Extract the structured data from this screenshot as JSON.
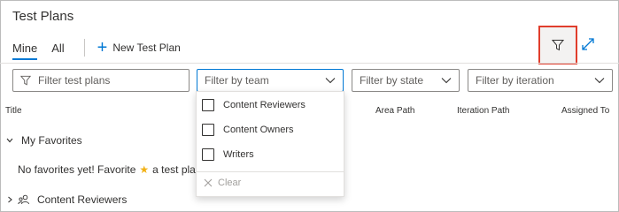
{
  "page": {
    "title": "Test Plans"
  },
  "tabs": [
    {
      "label": "Mine"
    },
    {
      "label": "All"
    }
  ],
  "actions": {
    "new_plan_label": "New Test Plan"
  },
  "filters": {
    "plans_placeholder": "Filter test plans",
    "team_label": "Filter by team",
    "state_label": "Filter by state",
    "iteration_label": "Filter by iteration"
  },
  "columns": {
    "title": "Title",
    "area_path": "Area Path",
    "iteration_path": "Iteration Path",
    "assigned_to": "Assigned To"
  },
  "sections": {
    "favorites_label": "My Favorites",
    "empty_prefix": "No favorites yet! Favorite",
    "empty_suffix": "a test plan",
    "group_label": "Content Reviewers"
  },
  "team_dropdown": {
    "options": [
      {
        "label": "Content Reviewers"
      },
      {
        "label": "Content Owners"
      },
      {
        "label": "Writers"
      }
    ],
    "clear_label": "Clear"
  },
  "colors": {
    "accent": "#0078d4",
    "highlight": "#e03d2c",
    "star": "#f2b114"
  }
}
